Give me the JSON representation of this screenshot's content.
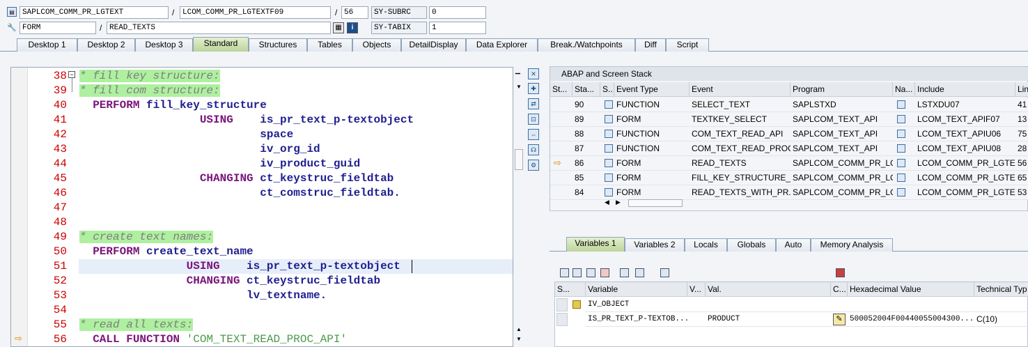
{
  "header": {
    "program": "SAPLCOM_COMM_PR_LGTEXT",
    "include": "LCOM_COMM_PR_LGTEXTF09",
    "line": "56",
    "subrc_label": "SY-SUBRC",
    "subrc_value": "0",
    "event_type": "FORM",
    "event": "READ_TEXTS",
    "tabix_label": "SY-TABIX",
    "tabix_value": "1"
  },
  "tabs": [
    "Desktop 1",
    "Desktop 2",
    "Desktop 3",
    "Standard",
    "Structures",
    "Tables",
    "Objects",
    "DetailDisplay",
    "Data Explorer",
    "Break./Watchpoints",
    "Diff",
    "Script"
  ],
  "active_tab": "Standard",
  "editor": {
    "lines": [
      {
        "n": "38",
        "parts": [
          {
            "t": "* fill key structure:",
            "c": "cmt"
          }
        ]
      },
      {
        "n": "39",
        "parts": [
          {
            "t": "* fill com structure:",
            "c": "cmt"
          }
        ]
      },
      {
        "n": "40",
        "parts": [
          {
            "t": "  PERFORM ",
            "c": "kw"
          },
          {
            "t": "fill_key_structure",
            "c": ""
          }
        ]
      },
      {
        "n": "41",
        "parts": [
          {
            "t": "                  USING    ",
            "c": "kw"
          },
          {
            "t": "is_pr_text_p-textobject",
            "c": ""
          }
        ]
      },
      {
        "n": "42",
        "parts": [
          {
            "t": "                           space",
            "c": ""
          }
        ]
      },
      {
        "n": "43",
        "parts": [
          {
            "t": "                           iv_org_id",
            "c": ""
          }
        ]
      },
      {
        "n": "44",
        "parts": [
          {
            "t": "                           iv_product_guid",
            "c": ""
          }
        ]
      },
      {
        "n": "45",
        "parts": [
          {
            "t": "                  CHANGING ",
            "c": "kw"
          },
          {
            "t": "ct_keystruc_fieldtab",
            "c": ""
          }
        ]
      },
      {
        "n": "46",
        "parts": [
          {
            "t": "                           ct_comstruc_fieldtab.",
            "c": ""
          }
        ]
      },
      {
        "n": "47",
        "parts": []
      },
      {
        "n": "48",
        "parts": []
      },
      {
        "n": "49",
        "parts": [
          {
            "t": "* create text names:",
            "c": "cmt"
          }
        ]
      },
      {
        "n": "50",
        "parts": [
          {
            "t": "  PERFORM ",
            "c": "kw"
          },
          {
            "t": "create_text_name",
            "c": ""
          }
        ]
      },
      {
        "n": "51",
        "parts": [
          {
            "t": "                USING    ",
            "c": "kw"
          },
          {
            "t": "is_pr_text_p-textobject",
            "c": ""
          }
        ]
      },
      {
        "n": "52",
        "parts": [
          {
            "t": "                CHANGING ",
            "c": "kw"
          },
          {
            "t": "ct_keystruc_fieldtab",
            "c": ""
          }
        ]
      },
      {
        "n": "53",
        "parts": [
          {
            "t": "                         lv_textname.",
            "c": ""
          }
        ]
      },
      {
        "n": "54",
        "parts": []
      },
      {
        "n": "55",
        "parts": [
          {
            "t": "* read all texts:",
            "c": "cmt"
          }
        ]
      },
      {
        "n": "56",
        "parts": [
          {
            "t": "  CALL FUNCTION ",
            "c": "kw"
          },
          {
            "t": "'COM_TEXT_READ_PROC_API'",
            "c": "str"
          }
        ]
      }
    ]
  },
  "stack": {
    "title": "ABAP and Screen Stack",
    "columns": [
      "St...",
      "Sta...",
      "S..",
      "Event Type",
      "Event",
      "Program",
      "Na...",
      "Include",
      "Lin"
    ],
    "rows": [
      {
        "level": "90",
        "type": "FUNCTION",
        "event": "SELECT_TEXT",
        "program": "SAPLSTXD",
        "include": "LSTXDU07",
        "line": "41",
        "current": false
      },
      {
        "level": "89",
        "type": "FORM",
        "event": "TEXTKEY_SELECT",
        "program": "SAPLCOM_TEXT_API",
        "include": "LCOM_TEXT_APIF07",
        "line": "13",
        "current": false
      },
      {
        "level": "88",
        "type": "FUNCTION",
        "event": "COM_TEXT_READ_API",
        "program": "SAPLCOM_TEXT_API",
        "include": "LCOM_TEXT_APIU06",
        "line": "75",
        "current": false
      },
      {
        "level": "87",
        "type": "FUNCTION",
        "event": "COM_TEXT_READ_PROC...",
        "program": "SAPLCOM_TEXT_API",
        "include": "LCOM_TEXT_APIU08",
        "line": "28",
        "current": false
      },
      {
        "level": "86",
        "type": "FORM",
        "event": "READ_TEXTS",
        "program": "SAPLCOM_COMM_PR_LG...",
        "include": "LCOM_COMM_PR_LGTEX...",
        "line": "56",
        "current": true
      },
      {
        "level": "85",
        "type": "FORM",
        "event": "FILL_KEY_STRUCTURE_...",
        "program": "SAPLCOM_COMM_PR_LG...",
        "include": "LCOM_COMM_PR_LGTEX...",
        "line": "65",
        "current": false
      },
      {
        "level": "84",
        "type": "FORM",
        "event": "READ_TEXTS_WITH_PR...",
        "program": "SAPLCOM_COMM_PR_LG...",
        "include": "LCOM_COMM_PR_LGTEX...",
        "line": "53",
        "current": false
      }
    ]
  },
  "vartabs": [
    "Variables 1",
    "Variables 2",
    "Locals",
    "Globals",
    "Auto",
    "Memory Analysis"
  ],
  "active_vartab": "Variables 1",
  "variables": {
    "columns": [
      "S...",
      "Variable",
      "V...",
      "Val.",
      "C...",
      "Hexadecimal Value",
      "Technical Typ"
    ],
    "rows": [
      {
        "name": "IV_OBJECT",
        "value": "",
        "hex": "",
        "type": ""
      },
      {
        "name": "IS_PR_TEXT_P-TEXTOB...",
        "value": "PRODUCT",
        "hex": "500052004F00440055004300...",
        "type": "C(10)"
      }
    ]
  }
}
